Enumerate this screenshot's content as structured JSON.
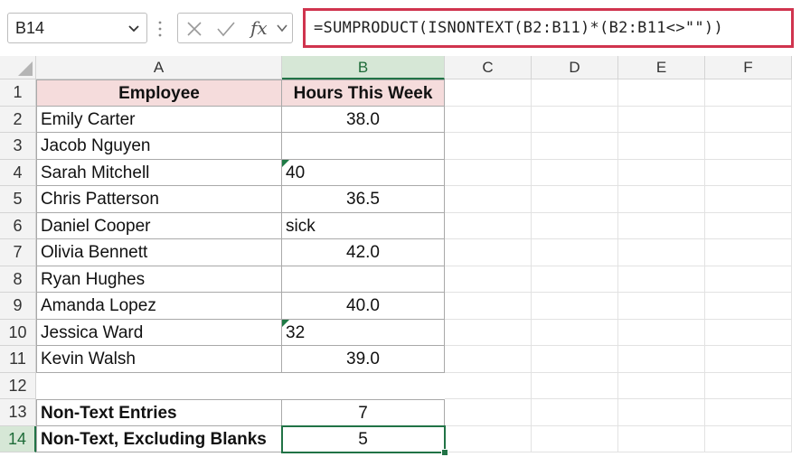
{
  "name_box": {
    "value": "B14"
  },
  "formula_bar": {
    "fx_label": "fx",
    "formula": "=SUMPRODUCT(ISNONTEXT(B2:B11)*(B2:B11<>\"\"))"
  },
  "sheet": {
    "columns": [
      "A",
      "B",
      "C",
      "D",
      "E",
      "F"
    ],
    "rows": [
      "1",
      "2",
      "3",
      "4",
      "5",
      "6",
      "7",
      "8",
      "9",
      "10",
      "11",
      "12",
      "13",
      "14"
    ],
    "header": {
      "col_a": "Employee",
      "col_b": "Hours This Week"
    },
    "data": [
      {
        "name": "Emily Carter",
        "hours": "38.0",
        "text": false
      },
      {
        "name": "Jacob Nguyen",
        "hours": "",
        "text": false
      },
      {
        "name": "Sarah Mitchell",
        "hours": "40",
        "text": true,
        "flag": true
      },
      {
        "name": "Chris Patterson",
        "hours": "36.5",
        "text": false
      },
      {
        "name": "Daniel Cooper",
        "hours": "sick",
        "text": true
      },
      {
        "name": "Olivia Bennett",
        "hours": "42.0",
        "text": false
      },
      {
        "name": "Ryan Hughes",
        "hours": "",
        "text": false
      },
      {
        "name": "Amanda Lopez",
        "hours": "40.0",
        "text": false
      },
      {
        "name": "Jessica Ward",
        "hours": "32",
        "text": true,
        "flag": true
      },
      {
        "name": "Kevin Walsh",
        "hours": "39.0",
        "text": false
      }
    ],
    "summary": [
      {
        "label": "Non-Text Entries",
        "value": "7"
      },
      {
        "label": "Non-Text, Excluding Blanks",
        "value": "5"
      }
    ],
    "selected_cell": "B14",
    "accent_color": "#217346",
    "highlight_border": "#d0344e",
    "header_fill": "#f5dcdc"
  }
}
